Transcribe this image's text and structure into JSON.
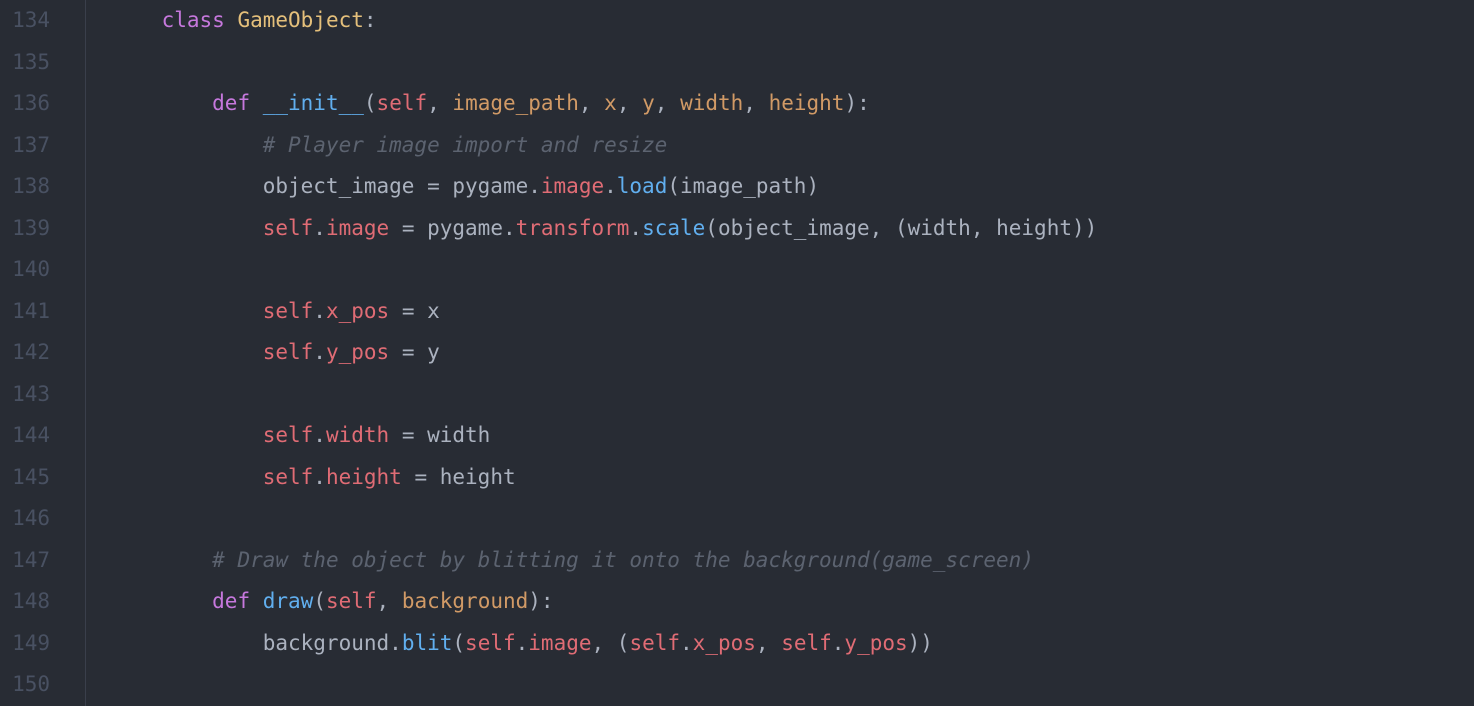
{
  "editor": {
    "language": "python",
    "theme": "one-dark",
    "gutter": [
      "134",
      "135",
      "136",
      "137",
      "138",
      "139",
      "140",
      "141",
      "142",
      "143",
      "144",
      "145",
      "146",
      "147",
      "148",
      "149",
      "150"
    ],
    "lines": [
      {
        "indent": 1,
        "tokens": [
          {
            "t": "class ",
            "c": "keyword"
          },
          {
            "t": "GameObject",
            "c": "classname"
          },
          {
            "t": ":",
            "c": "punct"
          }
        ]
      },
      {
        "indent": 0,
        "tokens": []
      },
      {
        "indent": 2,
        "tokens": [
          {
            "t": "def ",
            "c": "keyword"
          },
          {
            "t": "__init__",
            "c": "funcname"
          },
          {
            "t": "(",
            "c": "punct"
          },
          {
            "t": "self",
            "c": "self"
          },
          {
            "t": ", ",
            "c": "punct"
          },
          {
            "t": "image_path",
            "c": "param"
          },
          {
            "t": ", ",
            "c": "punct"
          },
          {
            "t": "x",
            "c": "param"
          },
          {
            "t": ", ",
            "c": "punct"
          },
          {
            "t": "y",
            "c": "param"
          },
          {
            "t": ", ",
            "c": "punct"
          },
          {
            "t": "width",
            "c": "param"
          },
          {
            "t": ", ",
            "c": "punct"
          },
          {
            "t": "height",
            "c": "param"
          },
          {
            "t": "):",
            "c": "punct"
          }
        ]
      },
      {
        "indent": 3,
        "tokens": [
          {
            "t": "# Player image import and resize",
            "c": "comment"
          }
        ]
      },
      {
        "indent": 3,
        "tokens": [
          {
            "t": "object_image",
            "c": "ident"
          },
          {
            "t": " = ",
            "c": "punct"
          },
          {
            "t": "pygame",
            "c": "ident"
          },
          {
            "t": ".",
            "c": "punct"
          },
          {
            "t": "image",
            "c": "attr"
          },
          {
            "t": ".",
            "c": "punct"
          },
          {
            "t": "load",
            "c": "funcname"
          },
          {
            "t": "(",
            "c": "punct"
          },
          {
            "t": "image_path",
            "c": "ident"
          },
          {
            "t": ")",
            "c": "punct"
          }
        ]
      },
      {
        "indent": 3,
        "tokens": [
          {
            "t": "self",
            "c": "self"
          },
          {
            "t": ".",
            "c": "punct"
          },
          {
            "t": "image",
            "c": "attr"
          },
          {
            "t": " = ",
            "c": "punct"
          },
          {
            "t": "pygame",
            "c": "ident"
          },
          {
            "t": ".",
            "c": "punct"
          },
          {
            "t": "transform",
            "c": "attr"
          },
          {
            "t": ".",
            "c": "punct"
          },
          {
            "t": "scale",
            "c": "funcname"
          },
          {
            "t": "(",
            "c": "punct"
          },
          {
            "t": "object_image",
            "c": "ident"
          },
          {
            "t": ", (",
            "c": "punct"
          },
          {
            "t": "width",
            "c": "ident"
          },
          {
            "t": ", ",
            "c": "punct"
          },
          {
            "t": "height",
            "c": "ident"
          },
          {
            "t": "))",
            "c": "punct"
          }
        ]
      },
      {
        "indent": 0,
        "tokens": []
      },
      {
        "indent": 3,
        "tokens": [
          {
            "t": "self",
            "c": "self"
          },
          {
            "t": ".",
            "c": "punct"
          },
          {
            "t": "x_pos",
            "c": "attr"
          },
          {
            "t": " = ",
            "c": "punct"
          },
          {
            "t": "x",
            "c": "ident"
          }
        ]
      },
      {
        "indent": 3,
        "tokens": [
          {
            "t": "self",
            "c": "self"
          },
          {
            "t": ".",
            "c": "punct"
          },
          {
            "t": "y_pos",
            "c": "attr"
          },
          {
            "t": " = ",
            "c": "punct"
          },
          {
            "t": "y",
            "c": "ident"
          }
        ]
      },
      {
        "indent": 0,
        "tokens": []
      },
      {
        "indent": 3,
        "tokens": [
          {
            "t": "self",
            "c": "self"
          },
          {
            "t": ".",
            "c": "punct"
          },
          {
            "t": "width",
            "c": "attr"
          },
          {
            "t": " = ",
            "c": "punct"
          },
          {
            "t": "width",
            "c": "ident"
          }
        ]
      },
      {
        "indent": 3,
        "tokens": [
          {
            "t": "self",
            "c": "self"
          },
          {
            "t": ".",
            "c": "punct"
          },
          {
            "t": "height",
            "c": "attr"
          },
          {
            "t": " = ",
            "c": "punct"
          },
          {
            "t": "height",
            "c": "ident"
          }
        ]
      },
      {
        "indent": 0,
        "tokens": []
      },
      {
        "indent": 2,
        "tokens": [
          {
            "t": "# Draw the object by blitting it onto the background(game_screen)",
            "c": "comment"
          }
        ]
      },
      {
        "indent": 2,
        "tokens": [
          {
            "t": "def ",
            "c": "keyword"
          },
          {
            "t": "draw",
            "c": "funcname"
          },
          {
            "t": "(",
            "c": "punct"
          },
          {
            "t": "self",
            "c": "self"
          },
          {
            "t": ", ",
            "c": "punct"
          },
          {
            "t": "background",
            "c": "param"
          },
          {
            "t": "):",
            "c": "punct"
          }
        ]
      },
      {
        "indent": 3,
        "tokens": [
          {
            "t": "background",
            "c": "ident"
          },
          {
            "t": ".",
            "c": "punct"
          },
          {
            "t": "blit",
            "c": "funcname"
          },
          {
            "t": "(",
            "c": "punct"
          },
          {
            "t": "self",
            "c": "self"
          },
          {
            "t": ".",
            "c": "punct"
          },
          {
            "t": "image",
            "c": "attr"
          },
          {
            "t": ", (",
            "c": "punct"
          },
          {
            "t": "self",
            "c": "self"
          },
          {
            "t": ".",
            "c": "punct"
          },
          {
            "t": "x_pos",
            "c": "attr"
          },
          {
            "t": ", ",
            "c": "punct"
          },
          {
            "t": "self",
            "c": "self"
          },
          {
            "t": ".",
            "c": "punct"
          },
          {
            "t": "y_pos",
            "c": "attr"
          },
          {
            "t": "))",
            "c": "punct"
          }
        ]
      },
      {
        "indent": 0,
        "tokens": []
      }
    ]
  }
}
